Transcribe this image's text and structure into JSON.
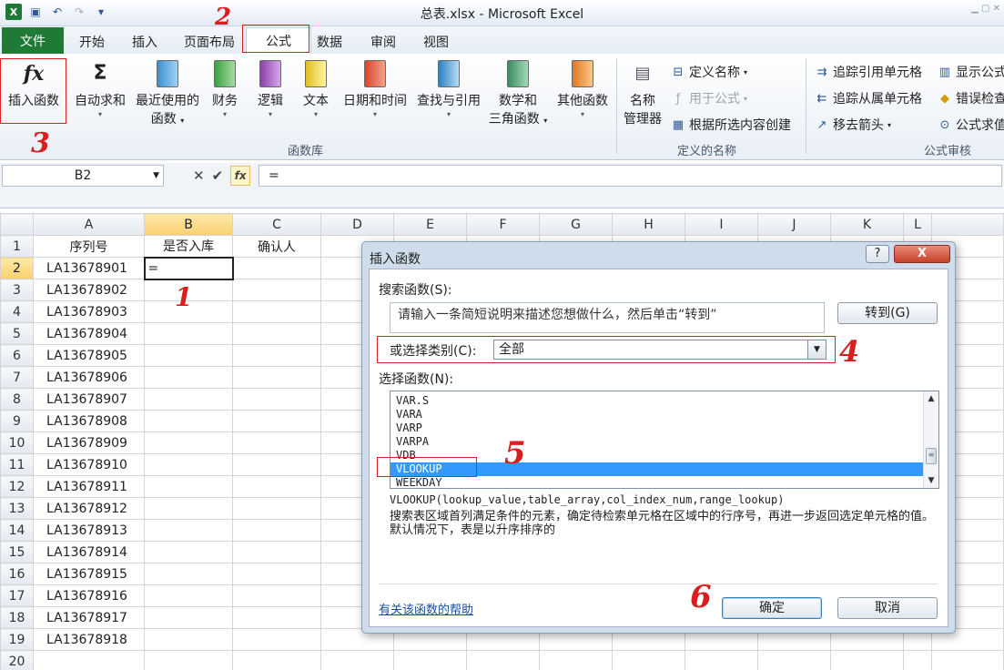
{
  "window": {
    "title": "总表.xlsx - Microsoft Excel"
  },
  "ribbon_tabs": [
    {
      "label": "文件"
    },
    {
      "label": "开始"
    },
    {
      "label": "插入"
    },
    {
      "label": "页面布局"
    },
    {
      "label": "公式"
    },
    {
      "label": "数据"
    },
    {
      "label": "审阅"
    },
    {
      "label": "视图"
    }
  ],
  "ribbon": {
    "insert_function": "插入函数",
    "autosum": "自动求和",
    "recent_1": "最近使用的",
    "recent_2": "函数",
    "financial": "财务",
    "logical": "逻辑",
    "text": "文本",
    "datetime": "日期和时间",
    "lookup": "查找与引用",
    "math_1": "数学和",
    "math_2": "三角函数",
    "other": "其他函数",
    "library_label": "函数库",
    "name_mgr_1": "名称",
    "name_mgr_2": "管理器",
    "define_name": "定义名称",
    "use_in_formula": "用于公式",
    "create_from_sel": "根据所选内容创建",
    "defined_names_label": "定义的名称",
    "trace_precedents": "追踪引用单元格",
    "trace_dependents": "追踪从属单元格",
    "remove_arrows": "移去箭头",
    "show_formulas": "显示公式",
    "error_checking": "错误检查",
    "evaluate_formula": "公式求值",
    "auditing_label": "公式审核"
  },
  "formula_bar": {
    "name_box": "B2",
    "formula": "=",
    "fx": "fx"
  },
  "sheet": {
    "columns": [
      "A",
      "B",
      "C",
      "D",
      "E",
      "F",
      "G",
      "H",
      "I",
      "J",
      "K",
      "L"
    ],
    "header_row": [
      "序列号",
      "是否入库",
      "确认人"
    ],
    "rows": [
      {
        "n": "1"
      },
      {
        "n": "2",
        "a": "LA13678901",
        "b": "="
      },
      {
        "n": "3",
        "a": "LA13678902"
      },
      {
        "n": "4",
        "a": "LA13678903"
      },
      {
        "n": "5",
        "a": "LA13678904"
      },
      {
        "n": "6",
        "a": "LA13678905"
      },
      {
        "n": "7",
        "a": "LA13678906"
      },
      {
        "n": "8",
        "a": "LA13678907"
      },
      {
        "n": "9",
        "a": "LA13678908"
      },
      {
        "n": "10",
        "a": "LA13678909"
      },
      {
        "n": "11",
        "a": "LA13678910"
      },
      {
        "n": "12",
        "a": "LA13678911"
      },
      {
        "n": "13",
        "a": "LA13678912"
      },
      {
        "n": "14",
        "a": "LA13678913"
      },
      {
        "n": "15",
        "a": "LA13678914"
      },
      {
        "n": "16",
        "a": "LA13678915"
      },
      {
        "n": "17",
        "a": "LA13678916"
      },
      {
        "n": "18",
        "a": "LA13678917"
      },
      {
        "n": "19",
        "a": "LA13678918"
      },
      {
        "n": "20"
      }
    ]
  },
  "dialog": {
    "title": "插入函数",
    "help": "?",
    "close": "X",
    "search_label": "搜索函数(S):",
    "search_value": "请输入一条简短说明来描述您想做什么，然后单击“转到”",
    "go_button": "转到(G)",
    "category_label": "或选择类别(C):",
    "category_value": "全部",
    "function_label": "选择函数(N):",
    "functions": [
      "VAR.S",
      "VARA",
      "VARP",
      "VARPA",
      "VDB",
      "VLOOKUP",
      "WEEKDAY"
    ],
    "syntax": "VLOOKUP(lookup_value,table_array,col_index_num,range_lookup)",
    "description": "搜索表区域首列满足条件的元素，确定待检索单元格在区域中的行序号，再进一步返回选定单元格的值。默认情况下，表是以升序排序的",
    "help_link": "有关该函数的帮助",
    "ok": "确定",
    "cancel": "取消"
  },
  "annotations": [
    "1",
    "2",
    "3",
    "4",
    "5",
    "6"
  ]
}
